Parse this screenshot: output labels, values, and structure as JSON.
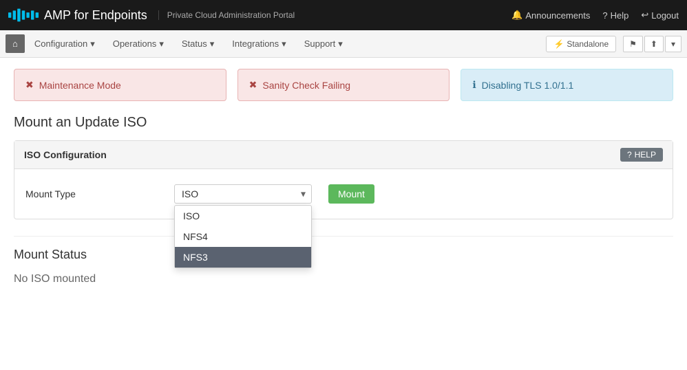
{
  "app": {
    "brand": "AMP for Endpoints",
    "subtitle": "Private Cloud Administration Portal",
    "logo_text": "cisco"
  },
  "navbar": {
    "announcements_label": "Announcements",
    "help_label": "Help",
    "logout_label": "Logout"
  },
  "subnav": {
    "home_icon": "⌂",
    "items": [
      {
        "label": "Configuration",
        "id": "configuration"
      },
      {
        "label": "Operations",
        "id": "operations"
      },
      {
        "label": "Status",
        "id": "status"
      },
      {
        "label": "Integrations",
        "id": "integrations"
      },
      {
        "label": "Support",
        "id": "support"
      }
    ],
    "standalone_label": "Standalone",
    "standalone_icon": "⚡"
  },
  "alerts": [
    {
      "type": "danger",
      "icon": "✖",
      "text": "Maintenance Mode"
    },
    {
      "type": "danger",
      "icon": "✖",
      "text": "Sanity Check Failing"
    },
    {
      "type": "info",
      "icon": "ℹ",
      "text": "Disabling TLS 1.0/1.1"
    }
  ],
  "iso_section": {
    "title": "Mount an Update ISO",
    "panel_title": "ISO Configuration",
    "help_label": "HELP",
    "help_icon": "?",
    "mount_type_label": "Mount Type",
    "select_value": "ISO",
    "select_options": [
      {
        "label": "ISO",
        "value": "ISO",
        "active": false
      },
      {
        "label": "NFS4",
        "value": "NFS4",
        "active": false
      },
      {
        "label": "NFS3",
        "value": "NFS3",
        "active": true
      }
    ]
  },
  "mount_status": {
    "title": "Mount Status",
    "status_text": "No ISO mounted"
  }
}
